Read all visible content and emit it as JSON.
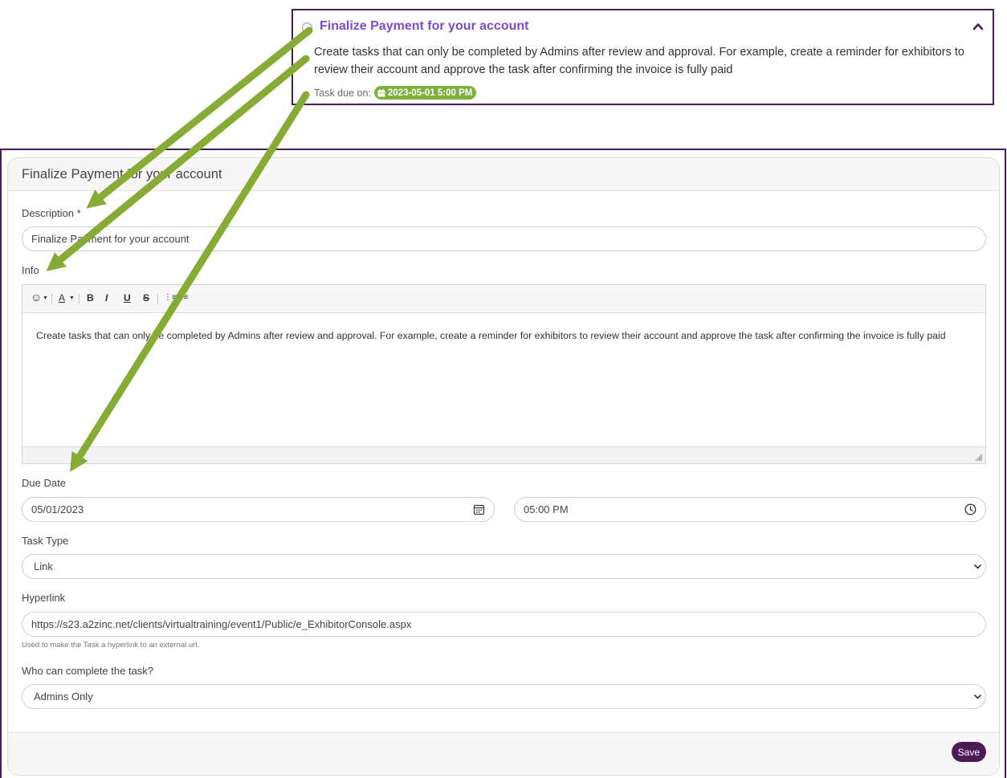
{
  "preview": {
    "title": "Finalize Payment for your account",
    "description": "Create tasks that can only be completed by Admins after review and approval. For example, create a reminder for exhibitors to review their account and approve the task after confirming the invoice is fully paid",
    "due_label": "Task due on:",
    "due_value": "2023-05-01 5:00 PM",
    "icons": [
      "radio-icon",
      "chevron-up-icon",
      "calendar-icon"
    ]
  },
  "form": {
    "title": "Finalize Payment for your account",
    "description_label": "Description *",
    "description_value": "Finalize Payment for your account",
    "info_label": "Info",
    "toolbar": {
      "emoji": "☺",
      "font_color": "A",
      "bold": "B",
      "italic": "I",
      "underline": "U",
      "strike": "S",
      "ordered_list": "⋮≡",
      "unordered_list": "•≡"
    },
    "info_content": "Create tasks that can only be completed by Admins after review and approval. For example, create a reminder for exhibitors to review their account and approve the task after confirming the invoice is fully paid",
    "due_date_label": "Due Date",
    "due_date_value": "05/01/2023",
    "due_time_value": "05:00 PM",
    "task_type_label": "Task Type",
    "task_type_value": "Link",
    "hyperlink_label": "Hyperlink",
    "hyperlink_value": "https://s23.a2zinc.net/clients/virtualtraining/event1/Public/e_ExhibitorConsole.aspx",
    "hyperlink_help": "Used to make the Task a hyperlink to an external url.",
    "who_label": "Who can complete the task?",
    "who_value": "Admins Only",
    "save_label": "Save"
  },
  "colors": {
    "frame": "#4b1e5a",
    "title_purple": "#7a4bd3",
    "badge_green": "#7eb03c",
    "arrow_green": "#86ac35",
    "save_bg": "#4b1a57"
  }
}
